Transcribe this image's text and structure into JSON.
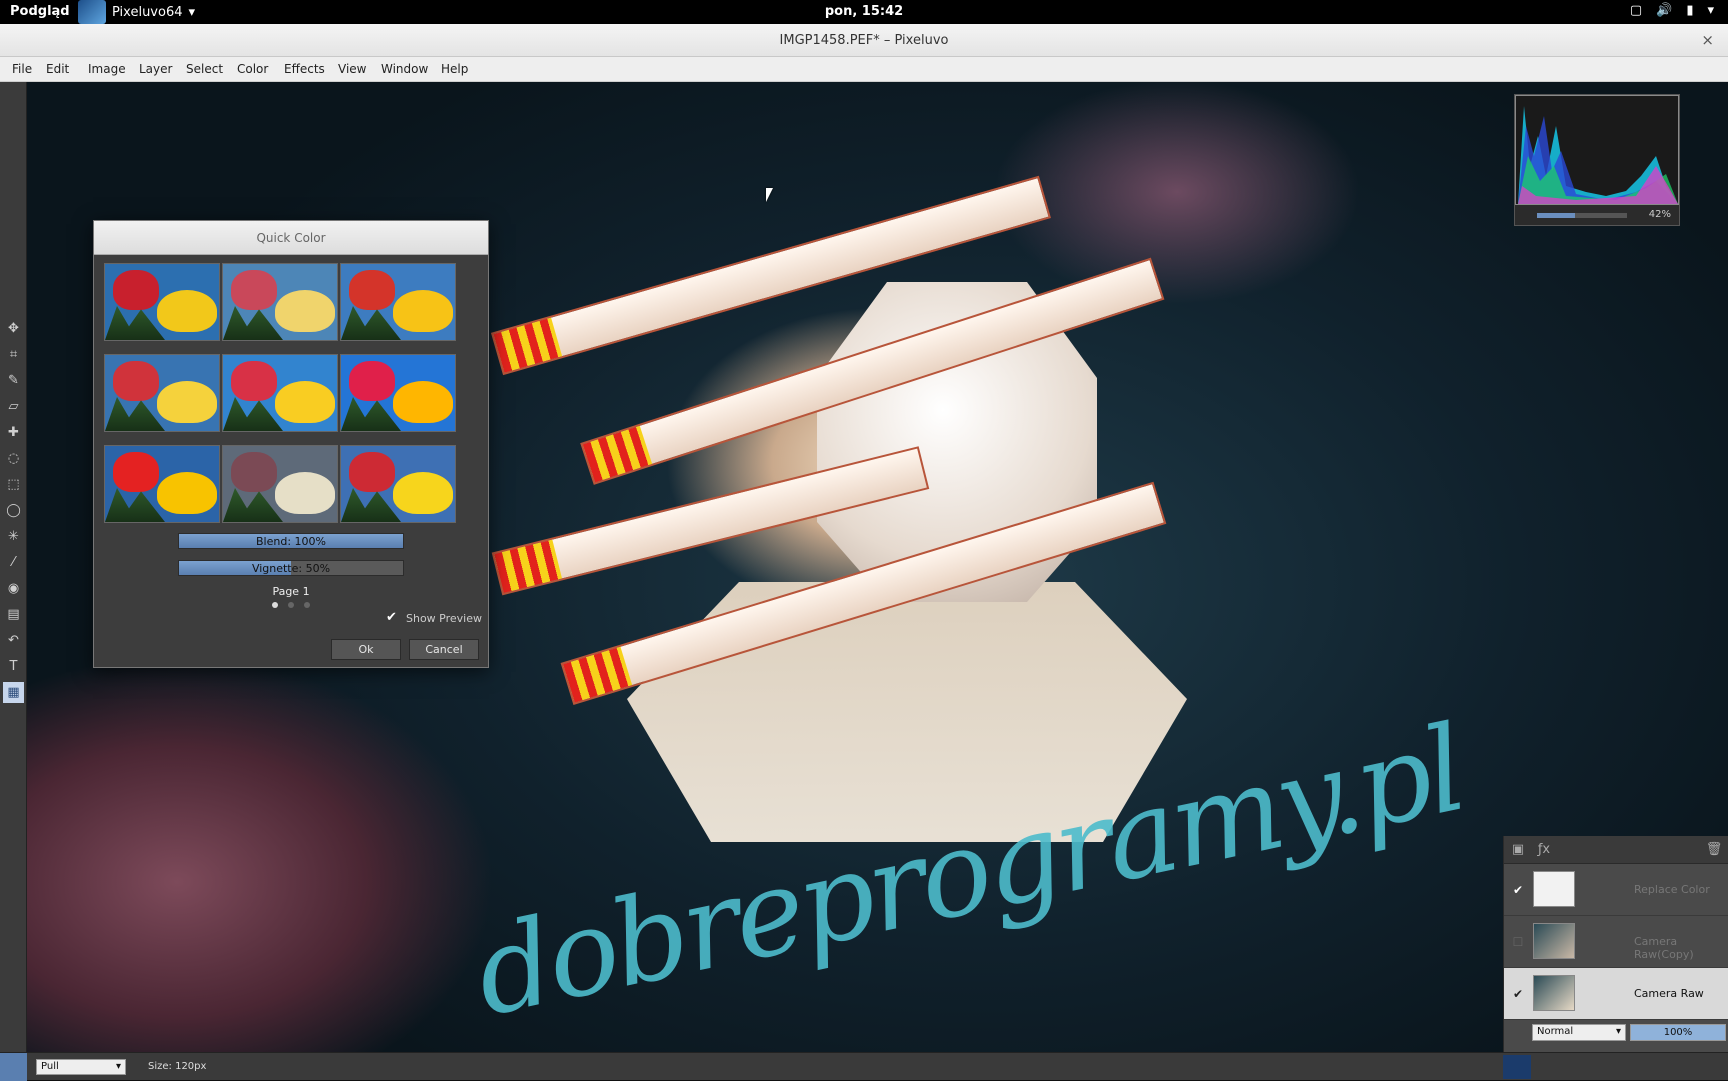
{
  "topbar": {
    "activities": "Podgląd",
    "app_name": "Pixeluvo64",
    "clock": "pon, 15:42"
  },
  "window": {
    "title": "IMGP1458.PEF* – Pixeluvo",
    "close": "×"
  },
  "menu": [
    "File",
    "Edit",
    "Image",
    "Layer",
    "Select",
    "Color",
    "Effects",
    "View",
    "Window",
    "Help"
  ],
  "canvas": {
    "handwriting": "dobreprogramy.pl"
  },
  "histogram": {
    "zoom_percent": "42%",
    "zoom_fraction": 0.42
  },
  "quick_color": {
    "title": "Quick Color",
    "blend": {
      "label": "Blend: 100%",
      "fraction": 1.0
    },
    "vignette": {
      "label": "Vignette: 50%",
      "fraction": 0.5
    },
    "page_label": "Page 1",
    "pages": 3,
    "current_page": 1,
    "show_preview": {
      "label": "Show Preview",
      "checked": true
    },
    "ok": "Ok",
    "cancel": "Cancel",
    "presets": [
      {
        "sky": "#2c6fb0",
        "red": "#c8202d",
        "yellow": "#f2c81a"
      },
      {
        "sky": "#4d86b7",
        "red": "#c9485a",
        "yellow": "#f0d46c"
      },
      {
        "sky": "#3d7cc0",
        "red": "#d4342a",
        "yellow": "#f7c316"
      },
      {
        "sky": "#3874b2",
        "red": "#d0333b",
        "yellow": "#f5d23c"
      },
      {
        "sky": "#3284cf",
        "red": "#d83146",
        "yellow": "#f9cd22"
      },
      {
        "sky": "#2475d6",
        "red": "#e0204a",
        "yellow": "#ffb600"
      },
      {
        "sky": "#2b64a8",
        "red": "#e42222",
        "yellow": "#f8c300"
      },
      {
        "sky": "#5e6a79",
        "red": "#7b4a55",
        "yellow": "#e6dfc7"
      },
      {
        "sky": "#3e70b4",
        "red": "#cd2a34",
        "yellow": "#f7d51c"
      }
    ]
  },
  "layers": {
    "items": [
      {
        "name": "Replace Color",
        "checked": true,
        "state": "dim"
      },
      {
        "name": "Camera Raw(Copy)",
        "checked": false,
        "state": "dim"
      },
      {
        "name": "Camera Raw",
        "checked": true,
        "state": "active"
      }
    ],
    "blend_mode": "Normal",
    "opacity": "100%"
  },
  "status": {
    "mode": "Pull",
    "size": "Size: 120px"
  },
  "icons": [
    "move-icon",
    "crop-icon",
    "brush-icon",
    "eraser-icon",
    "clone-icon",
    "lasso-icon",
    "marquee-icon",
    "ellipse-icon",
    "wand-icon",
    "eyedropper-icon",
    "eye-icon",
    "gradient-icon",
    "text-icon",
    "mesh-icon"
  ]
}
